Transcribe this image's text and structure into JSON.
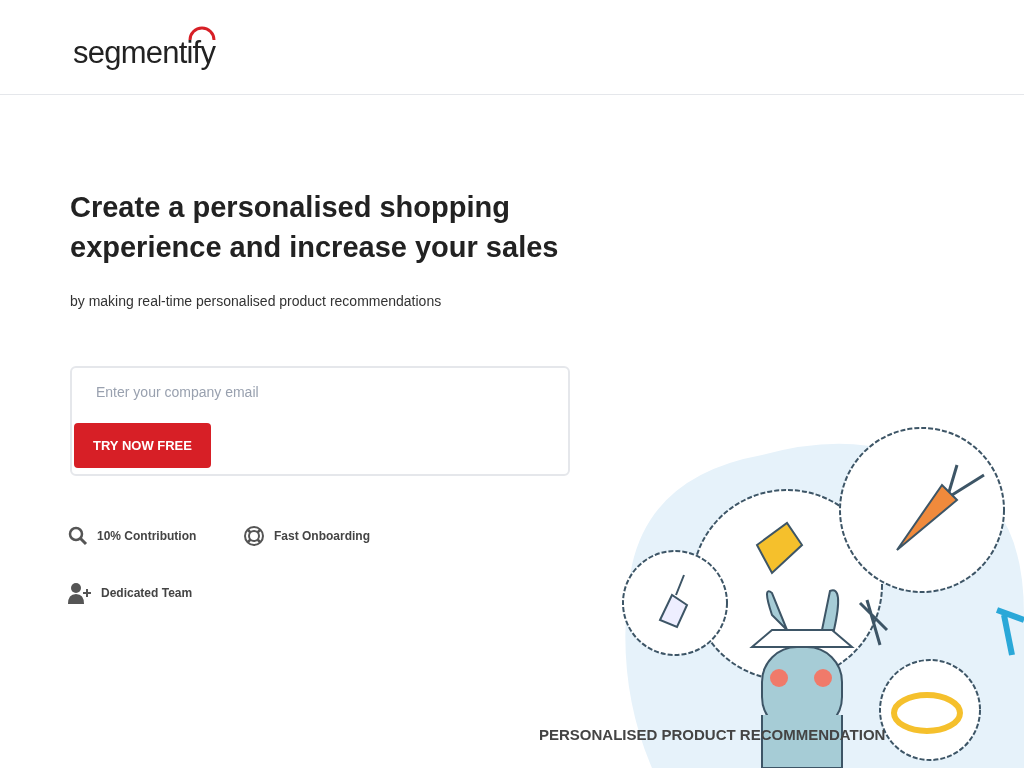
{
  "header": {
    "logo": "segmentify"
  },
  "hero": {
    "title": "Create a personalised shopping experience and increase your sales",
    "subtitle": "by making real-time personalised product recommendations"
  },
  "signup": {
    "placeholder": "Enter your company email",
    "button": "TRY NOW FREE"
  },
  "features": [
    {
      "kind": "search",
      "label": "10% Contribution"
    },
    {
      "kind": "lifebuoy",
      "label": "Fast Onboarding"
    },
    {
      "kind": "user-plus",
      "label": "Dedicated Team"
    }
  ],
  "illustration": {
    "caption": "PERSONALISED PRODUCT RECOMMENDATION"
  }
}
